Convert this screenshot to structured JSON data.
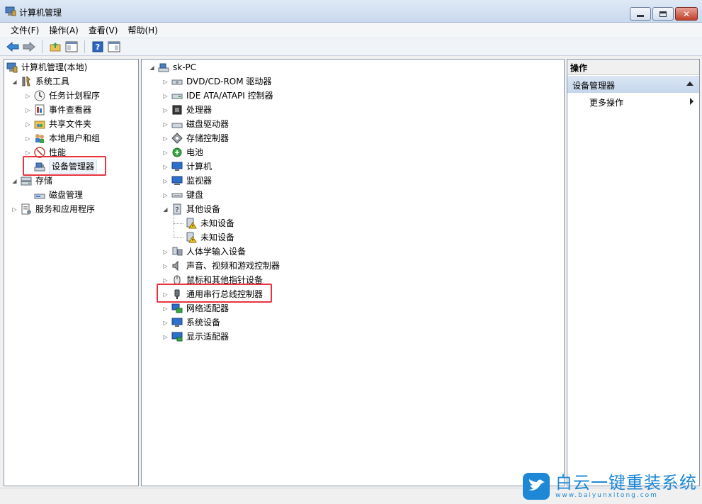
{
  "window": {
    "title": "计算机管理"
  },
  "menu": [
    "文件(F)",
    "操作(A)",
    "查看(V)",
    "帮助(H)"
  ],
  "left_tree": {
    "root": "计算机管理(本地)",
    "system_tools": "系统工具",
    "items": [
      "任务计划程序",
      "事件查看器",
      "共享文件夹",
      "本地用户和组",
      "性能",
      "设备管理器"
    ],
    "storage": "存储",
    "disk_management": "磁盘管理",
    "services": "服务和应用程序"
  },
  "device_tree": {
    "root": "sk-PC",
    "categories": [
      "DVD/CD-ROM 驱动器",
      "IDE ATA/ATAPI 控制器",
      "处理器",
      "磁盘驱动器",
      "存储控制器",
      "电池",
      "计算机",
      "监视器",
      "键盘",
      "其他设备"
    ],
    "other_devices": [
      "未知设备",
      "未知设备"
    ],
    "categories_after": [
      "人体学输入设备",
      "声音、视频和游戏控制器",
      "鼠标和其他指针设备",
      "通用串行总线控制器",
      "网络适配器",
      "系统设备",
      "显示适配器"
    ]
  },
  "actions": {
    "header": "操作",
    "section": "设备管理器",
    "more": "更多操作"
  },
  "watermark": {
    "title": "白云一键重装系统",
    "url": "www.baiyunxitong.com"
  },
  "colors": {
    "highlight": "#e8343f",
    "accent": "#1e88d6"
  }
}
